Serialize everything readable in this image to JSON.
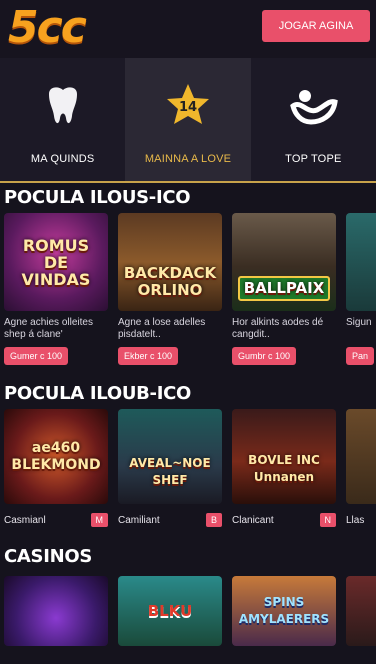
{
  "header": {
    "logo": "5cc",
    "cta_label": "JOGAR AGINA"
  },
  "tabs": [
    {
      "label": "MA QUINDS",
      "icon": "tooth-icon"
    },
    {
      "label": "MAINNA A LOVE",
      "icon": "star-14-icon",
      "badge": "14",
      "active": true
    },
    {
      "label": "TOP TOPE",
      "icon": "face-icon"
    }
  ],
  "section1": {
    "title": "POCULA ILOUS-ICO",
    "cards": [
      {
        "title": "ROMUS DE VINDAS",
        "desc": "Agne achies olleites shep á clane'",
        "button": "Gumer c 100"
      },
      {
        "title": "BACKDACK ORLINO",
        "desc": "Agne a lose adelles pisdatelt..",
        "button": "Ekber c 100"
      },
      {
        "title": "BALLPAIX",
        "desc": "Hor alkints aodes dé cangdit..",
        "button": "Gumbr c 100"
      },
      {
        "title": "",
        "desc": "Sigun",
        "button": "Pan"
      }
    ]
  },
  "section2": {
    "title": "POCULA ILOUB-ICO",
    "cards": [
      {
        "title": "ae460 BLEKMOND",
        "label": "Casmianl",
        "badge": "M"
      },
      {
        "title": "AVEAL~NOE SHEF",
        "label": "Camiliant",
        "badge": "B"
      },
      {
        "title": "BOVLE INC Unnanen",
        "label": "Clanicant",
        "badge": "N"
      },
      {
        "title": "",
        "label": "Llas",
        "badge": ""
      }
    ]
  },
  "section3": {
    "title": "CASINOS",
    "cards": [
      {
        "title": ""
      },
      {
        "title": "BLKU"
      },
      {
        "title": "SPINS AMYLAERERS"
      },
      {
        "title": ""
      }
    ]
  }
}
